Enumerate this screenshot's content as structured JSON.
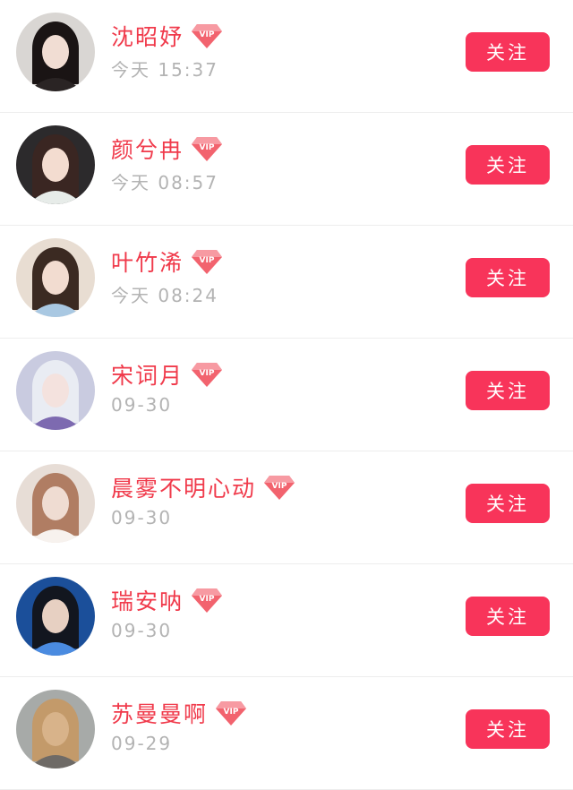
{
  "users": [
    {
      "name": "沈昭妤",
      "time": "今天 15:37",
      "follow_label": "关注",
      "vip": "VIP",
      "avatar": {
        "bg": "#d9d6d3",
        "hair": "#1a1414",
        "skin": "#f1ddd3",
        "accent": "#2a2424"
      }
    },
    {
      "name": "颜兮冉",
      "time": "今天 08:57",
      "follow_label": "关注",
      "vip": "VIP",
      "avatar": {
        "bg": "#2c2a2c",
        "hair": "#3a2622",
        "skin": "#f3dcd0",
        "accent": "#e7ece9"
      }
    },
    {
      "name": "叶竹浠",
      "time": "今天 08:24",
      "follow_label": "关注",
      "vip": "VIP",
      "avatar": {
        "bg": "#e8ddd2",
        "hair": "#3b2a22",
        "skin": "#f2dcd0",
        "accent": "#a9c8e2"
      }
    },
    {
      "name": "宋词月",
      "time": "09-30",
      "follow_label": "关注",
      "vip": "VIP",
      "avatar": {
        "bg": "#c9cbe0",
        "hair": "#e9ecf3",
        "skin": "#f4e2de",
        "accent": "#7d6ab0"
      }
    },
    {
      "name": "晨雾不明心动",
      "time": "09-30",
      "follow_label": "关注",
      "vip": "VIP",
      "avatar": {
        "bg": "#e7ddd6",
        "hair": "#b07d63",
        "skin": "#efdcd2",
        "accent": "#f7f2ee"
      }
    },
    {
      "name": "瑞安呐",
      "time": "09-30",
      "follow_label": "关注",
      "vip": "VIP",
      "avatar": {
        "bg": "#1b4f9a",
        "hair": "#12161f",
        "skin": "#e7d0c2",
        "accent": "#4a8be0"
      }
    },
    {
      "name": "苏曼曼啊",
      "time": "09-29",
      "follow_label": "关注",
      "vip": "VIP",
      "avatar": {
        "bg": "#a7aaa8",
        "hair": "#c39a6a",
        "skin": "#d8b38a",
        "accent": "#6e6a66"
      }
    }
  ],
  "colors": {
    "name": "#f03a4b",
    "time": "#b3b3b3",
    "follow_bg": "#f8345a",
    "follow_text": "#ffffff",
    "vip_diamond": "#f2636e",
    "divider": "#ededed"
  }
}
